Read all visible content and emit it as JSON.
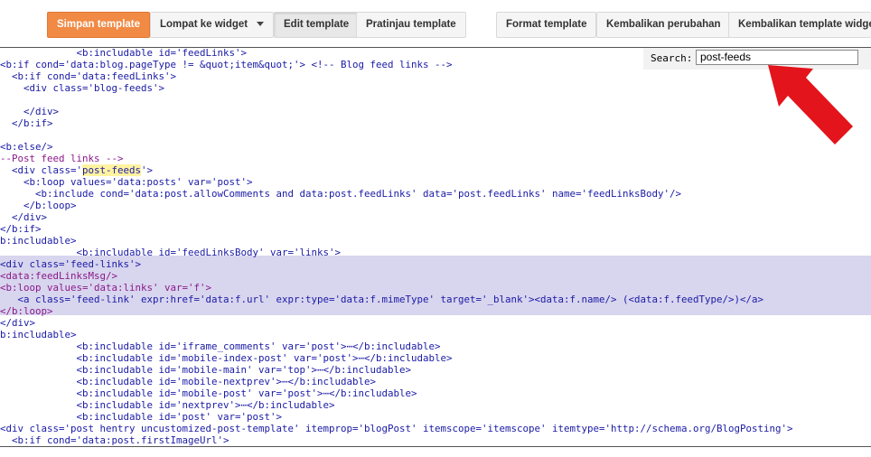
{
  "toolbar": {
    "save_label": "Simpan template",
    "jump_label": "Lompat ke widget",
    "edit_label": "Edit template",
    "preview_label": "Pratinjau template",
    "format_label": "Format template",
    "revert_label": "Kembalikan perubahan",
    "revert_widget_label": "Kembalikan template widget"
  },
  "search": {
    "label": "Search:",
    "value": "post-feeds"
  },
  "annotation": {
    "arrow_color": "#e3141b"
  },
  "colors": {
    "primary_button": "#f08a45",
    "highlight_band": "#d8d5ee",
    "search_match": "#fff3a0"
  },
  "code": {
    "l00": "             <b:includable id='feedLinks'>",
    "l01": "<b:if cond='data:blog.pageType != &quot;item&quot;'> <!-- Blog feed links -->",
    "l02": "  <b:if cond='data:feedLinks'>",
    "l03": "    <div class='blog-feeds'>",
    "l05": "    </div>",
    "l06": "  </b:if>",
    "l08": "<b:else/>",
    "l09": "--Post feed links -->",
    "l10a": "  <div class='",
    "l10b": "post-feeds",
    "l10c": "'>",
    "l11": "    <b:loop values='data:posts' var='post'>",
    "l12": "      <b:include cond='data:post.allowComments and data:post.feedLinks' data='post.feedLinks' name='feedLinksBody'/>",
    "l13": "    </b:loop>",
    "l14": "  </div>",
    "l15": "</b:if>",
    "l16": "b:includable>",
    "l17": "             <b:includable id='feedLinksBody' var='links'>",
    "l18": "<div class='feed-links'>",
    "l19": "<data:feedLinksMsg/>",
    "l20": "<b:loop values='data:links' var='f'>",
    "l21": "   <a class='feed-link' expr:href='data:f.url' expr:type='data:f.mimeType' target='_blank'><data:f.name/> (<data:f.feedType/>)</a>",
    "l22": "</b:loop>",
    "l23": "</div>",
    "l24": "b:includable>",
    "l25": "             <b:includable id='iframe_comments' var='post'>⋯</b:includable>",
    "l26": "             <b:includable id='mobile-index-post' var='post'>⋯</b:includable>",
    "l27": "             <b:includable id='mobile-main' var='top'>⋯</b:includable>",
    "l28": "             <b:includable id='mobile-nextprev'>⋯</b:includable>",
    "l29": "             <b:includable id='mobile-post' var='post'>⋯</b:includable>",
    "l30": "             <b:includable id='nextprev'>⋯</b:includable>",
    "l31": "             <b:includable id='post' var='post'>",
    "l32": "<div class='post hentry uncustomized-post-template' itemprop='blogPost' itemscope='itemscope' itemtype='http://schema.org/BlogPosting'>",
    "l33": "  <b:if cond='data:post.firstImageUrl'>"
  }
}
